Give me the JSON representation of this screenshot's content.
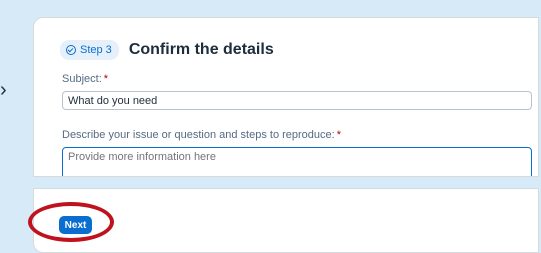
{
  "step": {
    "badge_label": "Step 3",
    "title": "Confirm the details"
  },
  "form": {
    "subject_label": "Subject:",
    "subject_required": "*",
    "subject_value": "What do you need",
    "description_label": "Describe your issue or question and steps to reproduce:",
    "description_required": "*",
    "description_placeholder": "Provide more information here"
  },
  "actions": {
    "next_label": "Next"
  },
  "annotation": {
    "highlight_color": "#c0121e"
  },
  "icons": {
    "step_badge_icon": "check-circle-icon",
    "side_marker": "chevron-icon"
  }
}
